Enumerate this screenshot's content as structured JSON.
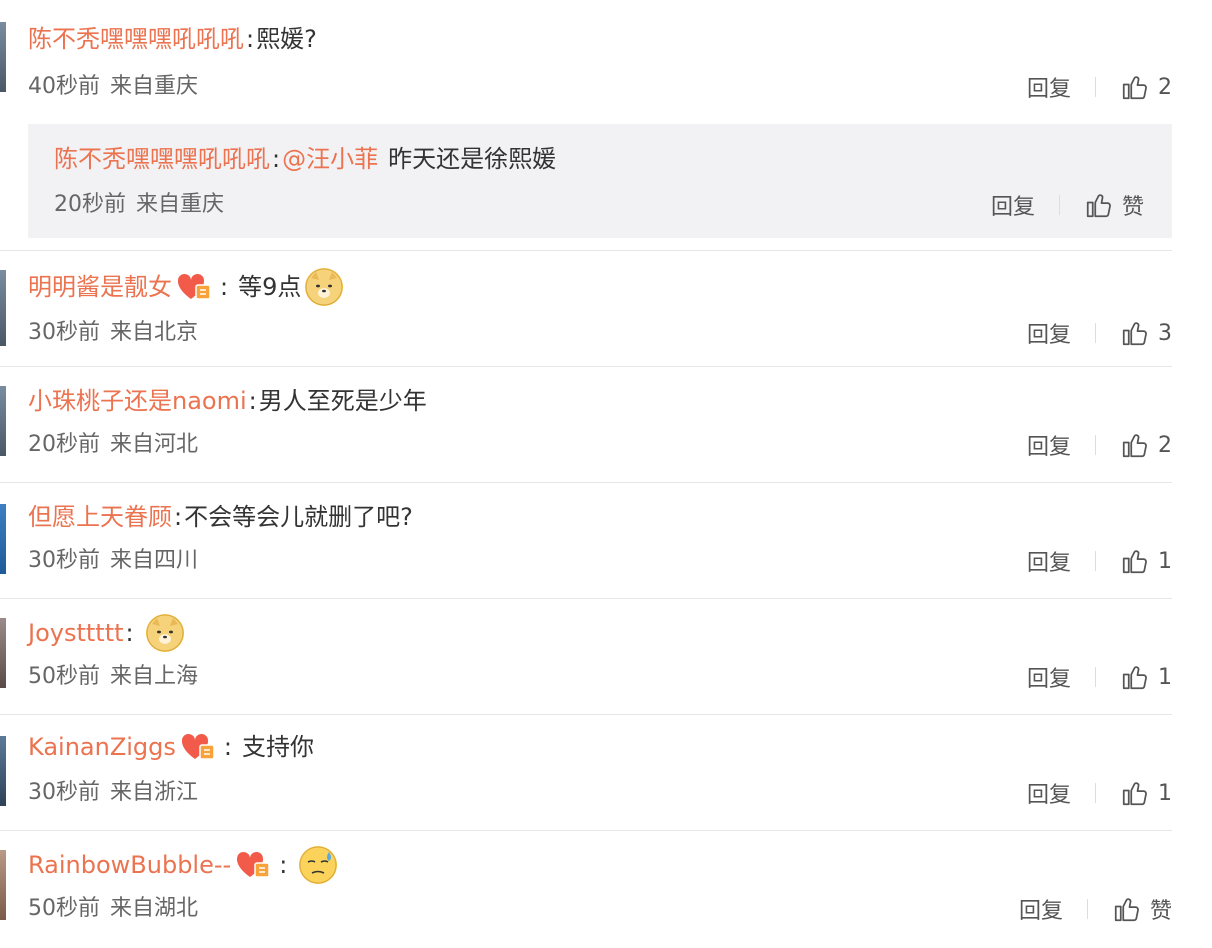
{
  "labels": {
    "reply": "回复",
    "praise": "赞"
  },
  "colors": {
    "username": "#eb7350",
    "text": "#333333",
    "meta": "#666666",
    "reply_bg": "#f2f2f5"
  },
  "comments": [
    {
      "username": "陈不秃嘿嘿嘿吼吼吼",
      "colon": ":",
      "text": "熙媛?",
      "time": "40秒前",
      "source": "来自重庆",
      "likes": "2",
      "reply": {
        "username": "陈不秃嘿嘿嘿吼吼吼",
        "colon": ":",
        "mention": "@汪小菲",
        "text": "昨天还是徐熙媛",
        "time": "20秒前",
        "source": "来自重庆",
        "likes": "赞"
      }
    },
    {
      "username": "明明酱是靓女",
      "badge": "vip-heart-badge",
      "colon": ":",
      "text": "等9点",
      "emoji": "doge-emoji",
      "time": "30秒前",
      "source": "来自北京",
      "likes": "3"
    },
    {
      "username": "小珠桃子还是naomi",
      "colon": ":",
      "text": "男人至死是少年",
      "time": "20秒前",
      "source": "来自河北",
      "likes": "2"
    },
    {
      "username": "但愿上天眷顾",
      "colon": ":",
      "text": "不会等会儿就删了吧?",
      "time": "30秒前",
      "source": "来自四川",
      "likes": "1"
    },
    {
      "username": "Joysttttt",
      "colon": ":",
      "emoji": "doge-emoji",
      "time": "50秒前",
      "source": "来自上海",
      "likes": "1"
    },
    {
      "username": "KainanZiggs",
      "badge": "vip-heart-badge",
      "colon": ":",
      "text": "支持你",
      "time": "30秒前",
      "source": "来自浙江",
      "likes": "1"
    },
    {
      "username": "RainbowBubble--",
      "badge": "vip-heart-badge",
      "colon": ":",
      "emoji": "sweat-emoji",
      "time": "50秒前",
      "source": "来自湖北",
      "likes": "赞"
    }
  ]
}
